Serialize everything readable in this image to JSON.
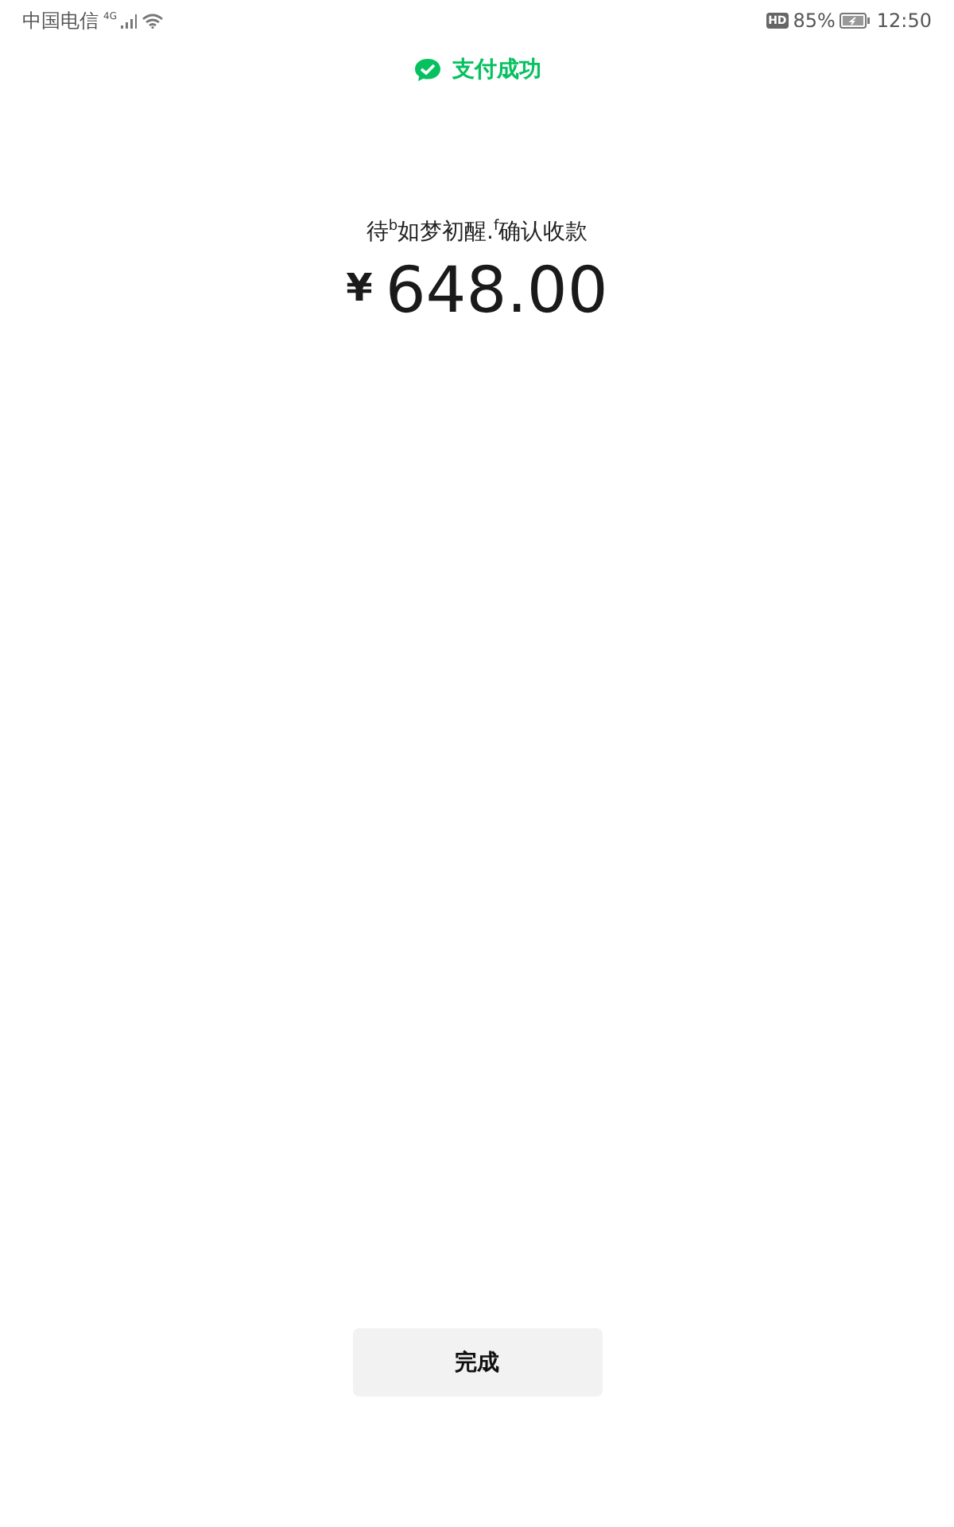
{
  "status_bar": {
    "carrier": "中国电信",
    "network": "4G",
    "hd": "HD",
    "battery": "85%",
    "time": "12:50"
  },
  "header": {
    "title": "支付成功"
  },
  "payment": {
    "payee": "待$^{b}$如梦初醒.$^{f}$确认收款",
    "currency": "¥",
    "amount": "648.00"
  },
  "buttons": [
    {
      "label": "完成"
    }
  ]
}
